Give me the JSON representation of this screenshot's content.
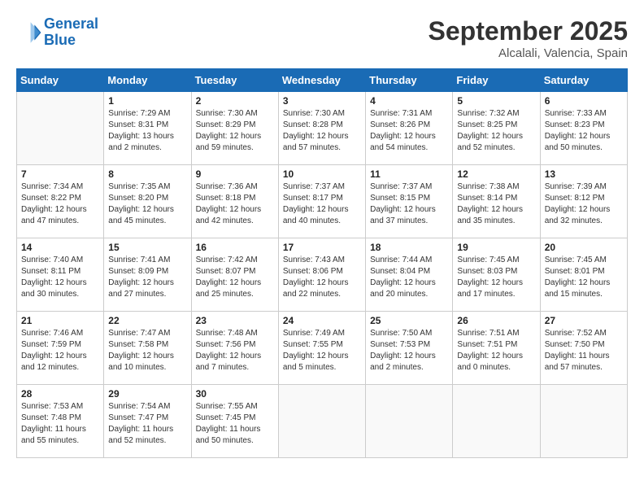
{
  "header": {
    "logo_line1": "General",
    "logo_line2": "Blue",
    "month_year": "September 2025",
    "location": "Alcalali, Valencia, Spain"
  },
  "days_of_week": [
    "Sunday",
    "Monday",
    "Tuesday",
    "Wednesday",
    "Thursday",
    "Friday",
    "Saturday"
  ],
  "weeks": [
    [
      {
        "day": "",
        "info": ""
      },
      {
        "day": "1",
        "info": "Sunrise: 7:29 AM\nSunset: 8:31 PM\nDaylight: 13 hours\nand 2 minutes."
      },
      {
        "day": "2",
        "info": "Sunrise: 7:30 AM\nSunset: 8:29 PM\nDaylight: 12 hours\nand 59 minutes."
      },
      {
        "day": "3",
        "info": "Sunrise: 7:30 AM\nSunset: 8:28 PM\nDaylight: 12 hours\nand 57 minutes."
      },
      {
        "day": "4",
        "info": "Sunrise: 7:31 AM\nSunset: 8:26 PM\nDaylight: 12 hours\nand 54 minutes."
      },
      {
        "day": "5",
        "info": "Sunrise: 7:32 AM\nSunset: 8:25 PM\nDaylight: 12 hours\nand 52 minutes."
      },
      {
        "day": "6",
        "info": "Sunrise: 7:33 AM\nSunset: 8:23 PM\nDaylight: 12 hours\nand 50 minutes."
      }
    ],
    [
      {
        "day": "7",
        "info": "Sunrise: 7:34 AM\nSunset: 8:22 PM\nDaylight: 12 hours\nand 47 minutes."
      },
      {
        "day": "8",
        "info": "Sunrise: 7:35 AM\nSunset: 8:20 PM\nDaylight: 12 hours\nand 45 minutes."
      },
      {
        "day": "9",
        "info": "Sunrise: 7:36 AM\nSunset: 8:18 PM\nDaylight: 12 hours\nand 42 minutes."
      },
      {
        "day": "10",
        "info": "Sunrise: 7:37 AM\nSunset: 8:17 PM\nDaylight: 12 hours\nand 40 minutes."
      },
      {
        "day": "11",
        "info": "Sunrise: 7:37 AM\nSunset: 8:15 PM\nDaylight: 12 hours\nand 37 minutes."
      },
      {
        "day": "12",
        "info": "Sunrise: 7:38 AM\nSunset: 8:14 PM\nDaylight: 12 hours\nand 35 minutes."
      },
      {
        "day": "13",
        "info": "Sunrise: 7:39 AM\nSunset: 8:12 PM\nDaylight: 12 hours\nand 32 minutes."
      }
    ],
    [
      {
        "day": "14",
        "info": "Sunrise: 7:40 AM\nSunset: 8:11 PM\nDaylight: 12 hours\nand 30 minutes."
      },
      {
        "day": "15",
        "info": "Sunrise: 7:41 AM\nSunset: 8:09 PM\nDaylight: 12 hours\nand 27 minutes."
      },
      {
        "day": "16",
        "info": "Sunrise: 7:42 AM\nSunset: 8:07 PM\nDaylight: 12 hours\nand 25 minutes."
      },
      {
        "day": "17",
        "info": "Sunrise: 7:43 AM\nSunset: 8:06 PM\nDaylight: 12 hours\nand 22 minutes."
      },
      {
        "day": "18",
        "info": "Sunrise: 7:44 AM\nSunset: 8:04 PM\nDaylight: 12 hours\nand 20 minutes."
      },
      {
        "day": "19",
        "info": "Sunrise: 7:45 AM\nSunset: 8:03 PM\nDaylight: 12 hours\nand 17 minutes."
      },
      {
        "day": "20",
        "info": "Sunrise: 7:45 AM\nSunset: 8:01 PM\nDaylight: 12 hours\nand 15 minutes."
      }
    ],
    [
      {
        "day": "21",
        "info": "Sunrise: 7:46 AM\nSunset: 7:59 PM\nDaylight: 12 hours\nand 12 minutes."
      },
      {
        "day": "22",
        "info": "Sunrise: 7:47 AM\nSunset: 7:58 PM\nDaylight: 12 hours\nand 10 minutes."
      },
      {
        "day": "23",
        "info": "Sunrise: 7:48 AM\nSunset: 7:56 PM\nDaylight: 12 hours\nand 7 minutes."
      },
      {
        "day": "24",
        "info": "Sunrise: 7:49 AM\nSunset: 7:55 PM\nDaylight: 12 hours\nand 5 minutes."
      },
      {
        "day": "25",
        "info": "Sunrise: 7:50 AM\nSunset: 7:53 PM\nDaylight: 12 hours\nand 2 minutes."
      },
      {
        "day": "26",
        "info": "Sunrise: 7:51 AM\nSunset: 7:51 PM\nDaylight: 12 hours\nand 0 minutes."
      },
      {
        "day": "27",
        "info": "Sunrise: 7:52 AM\nSunset: 7:50 PM\nDaylight: 11 hours\nand 57 minutes."
      }
    ],
    [
      {
        "day": "28",
        "info": "Sunrise: 7:53 AM\nSunset: 7:48 PM\nDaylight: 11 hours\nand 55 minutes."
      },
      {
        "day": "29",
        "info": "Sunrise: 7:54 AM\nSunset: 7:47 PM\nDaylight: 11 hours\nand 52 minutes."
      },
      {
        "day": "30",
        "info": "Sunrise: 7:55 AM\nSunset: 7:45 PM\nDaylight: 11 hours\nand 50 minutes."
      },
      {
        "day": "",
        "info": ""
      },
      {
        "day": "",
        "info": ""
      },
      {
        "day": "",
        "info": ""
      },
      {
        "day": "",
        "info": ""
      }
    ]
  ]
}
